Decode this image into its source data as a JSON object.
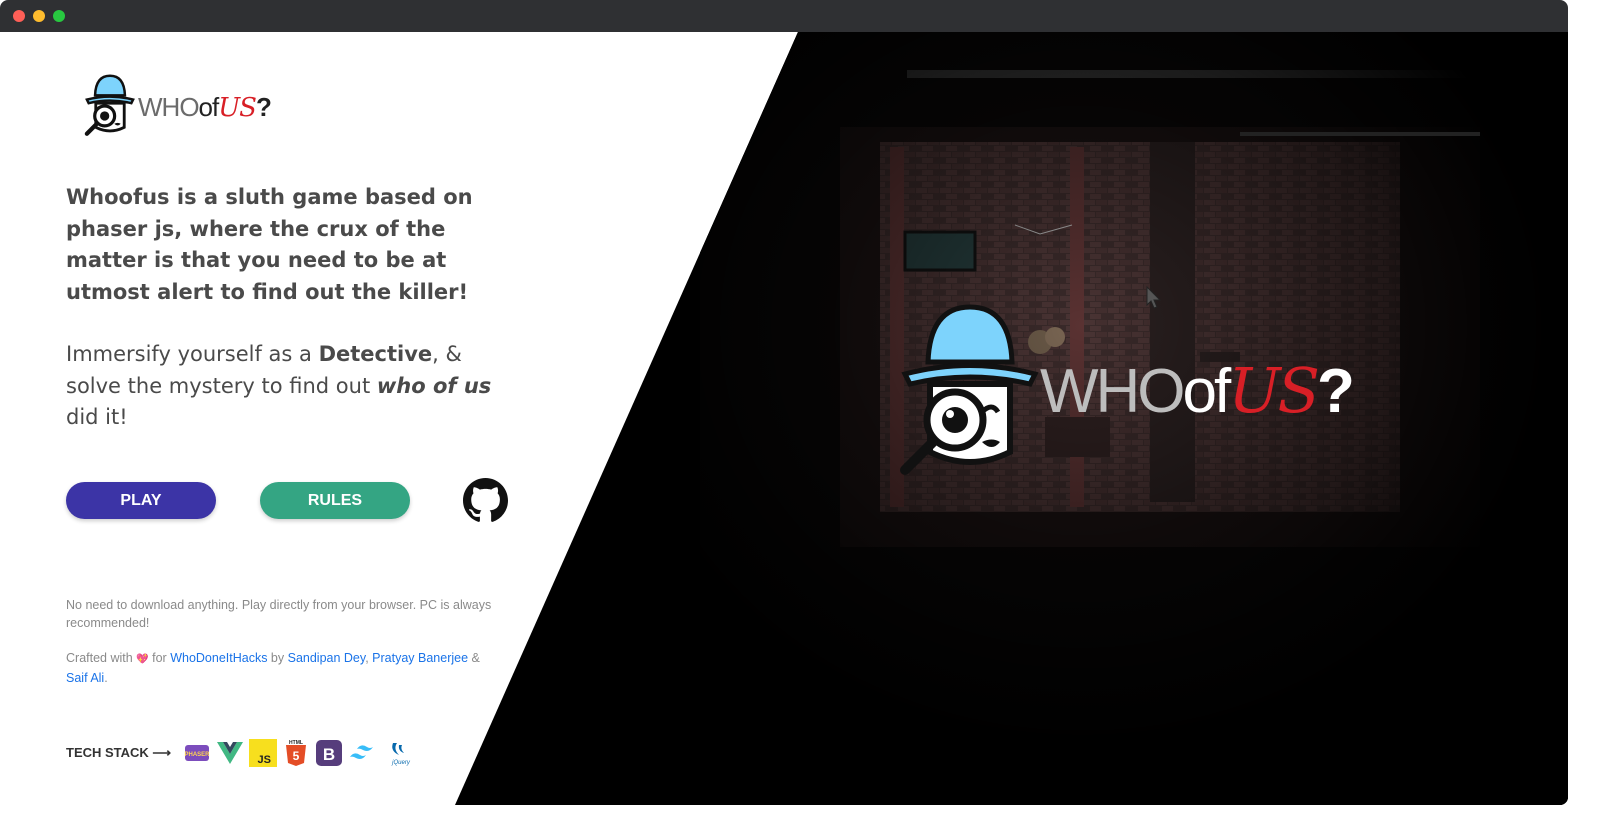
{
  "app": {
    "brand_who": "WHO",
    "brand_of": "of",
    "brand_us": "US",
    "brand_q": "?"
  },
  "hero": {
    "description": "Whoofus is a sluth game based on phaser js, where the crux of the matter is that you need to be at utmost alert to find out the killer!",
    "sub_prefix": "Immersify yourself as a ",
    "sub_bold": "Detective",
    "sub_middle": ", & solve the mystery to find out ",
    "sub_italic": "who of us",
    "sub_suffix": " did it!"
  },
  "buttons": {
    "play_label": "PLAY",
    "rules_label": "RULES"
  },
  "note": {
    "download_text": "No need to download anything. Play directly from your browser. PC is always recommended!"
  },
  "credits": {
    "prefix": "Crafted with",
    "heart": "💖",
    "for": " for ",
    "event": "WhoDoneItHacks",
    "by": " by ",
    "author1": "Sandipan Dey",
    "sep1": ", ",
    "author2": "Pratyay Banerjee",
    "amp": " &",
    "author3": "Saif Ali",
    "end": "."
  },
  "tech_stack": {
    "label": "TECH STACK ⟶",
    "icons": [
      "phaser-icon",
      "vue-icon",
      "javascript-icon",
      "html5-icon",
      "bootstrap-icon",
      "tailwind-icon",
      "jquery-icon"
    ],
    "html_text": "HTML",
    "js_text": "JS",
    "bootstrap_text": "B",
    "jquery_text": "jQuery",
    "phaser_text": "PHASER"
  },
  "colors": {
    "play": "#3c34a6",
    "rules": "#34a583",
    "link": "#1a73e8",
    "brand_red": "#d81f26",
    "hat_blue": "#7dd3fc"
  }
}
